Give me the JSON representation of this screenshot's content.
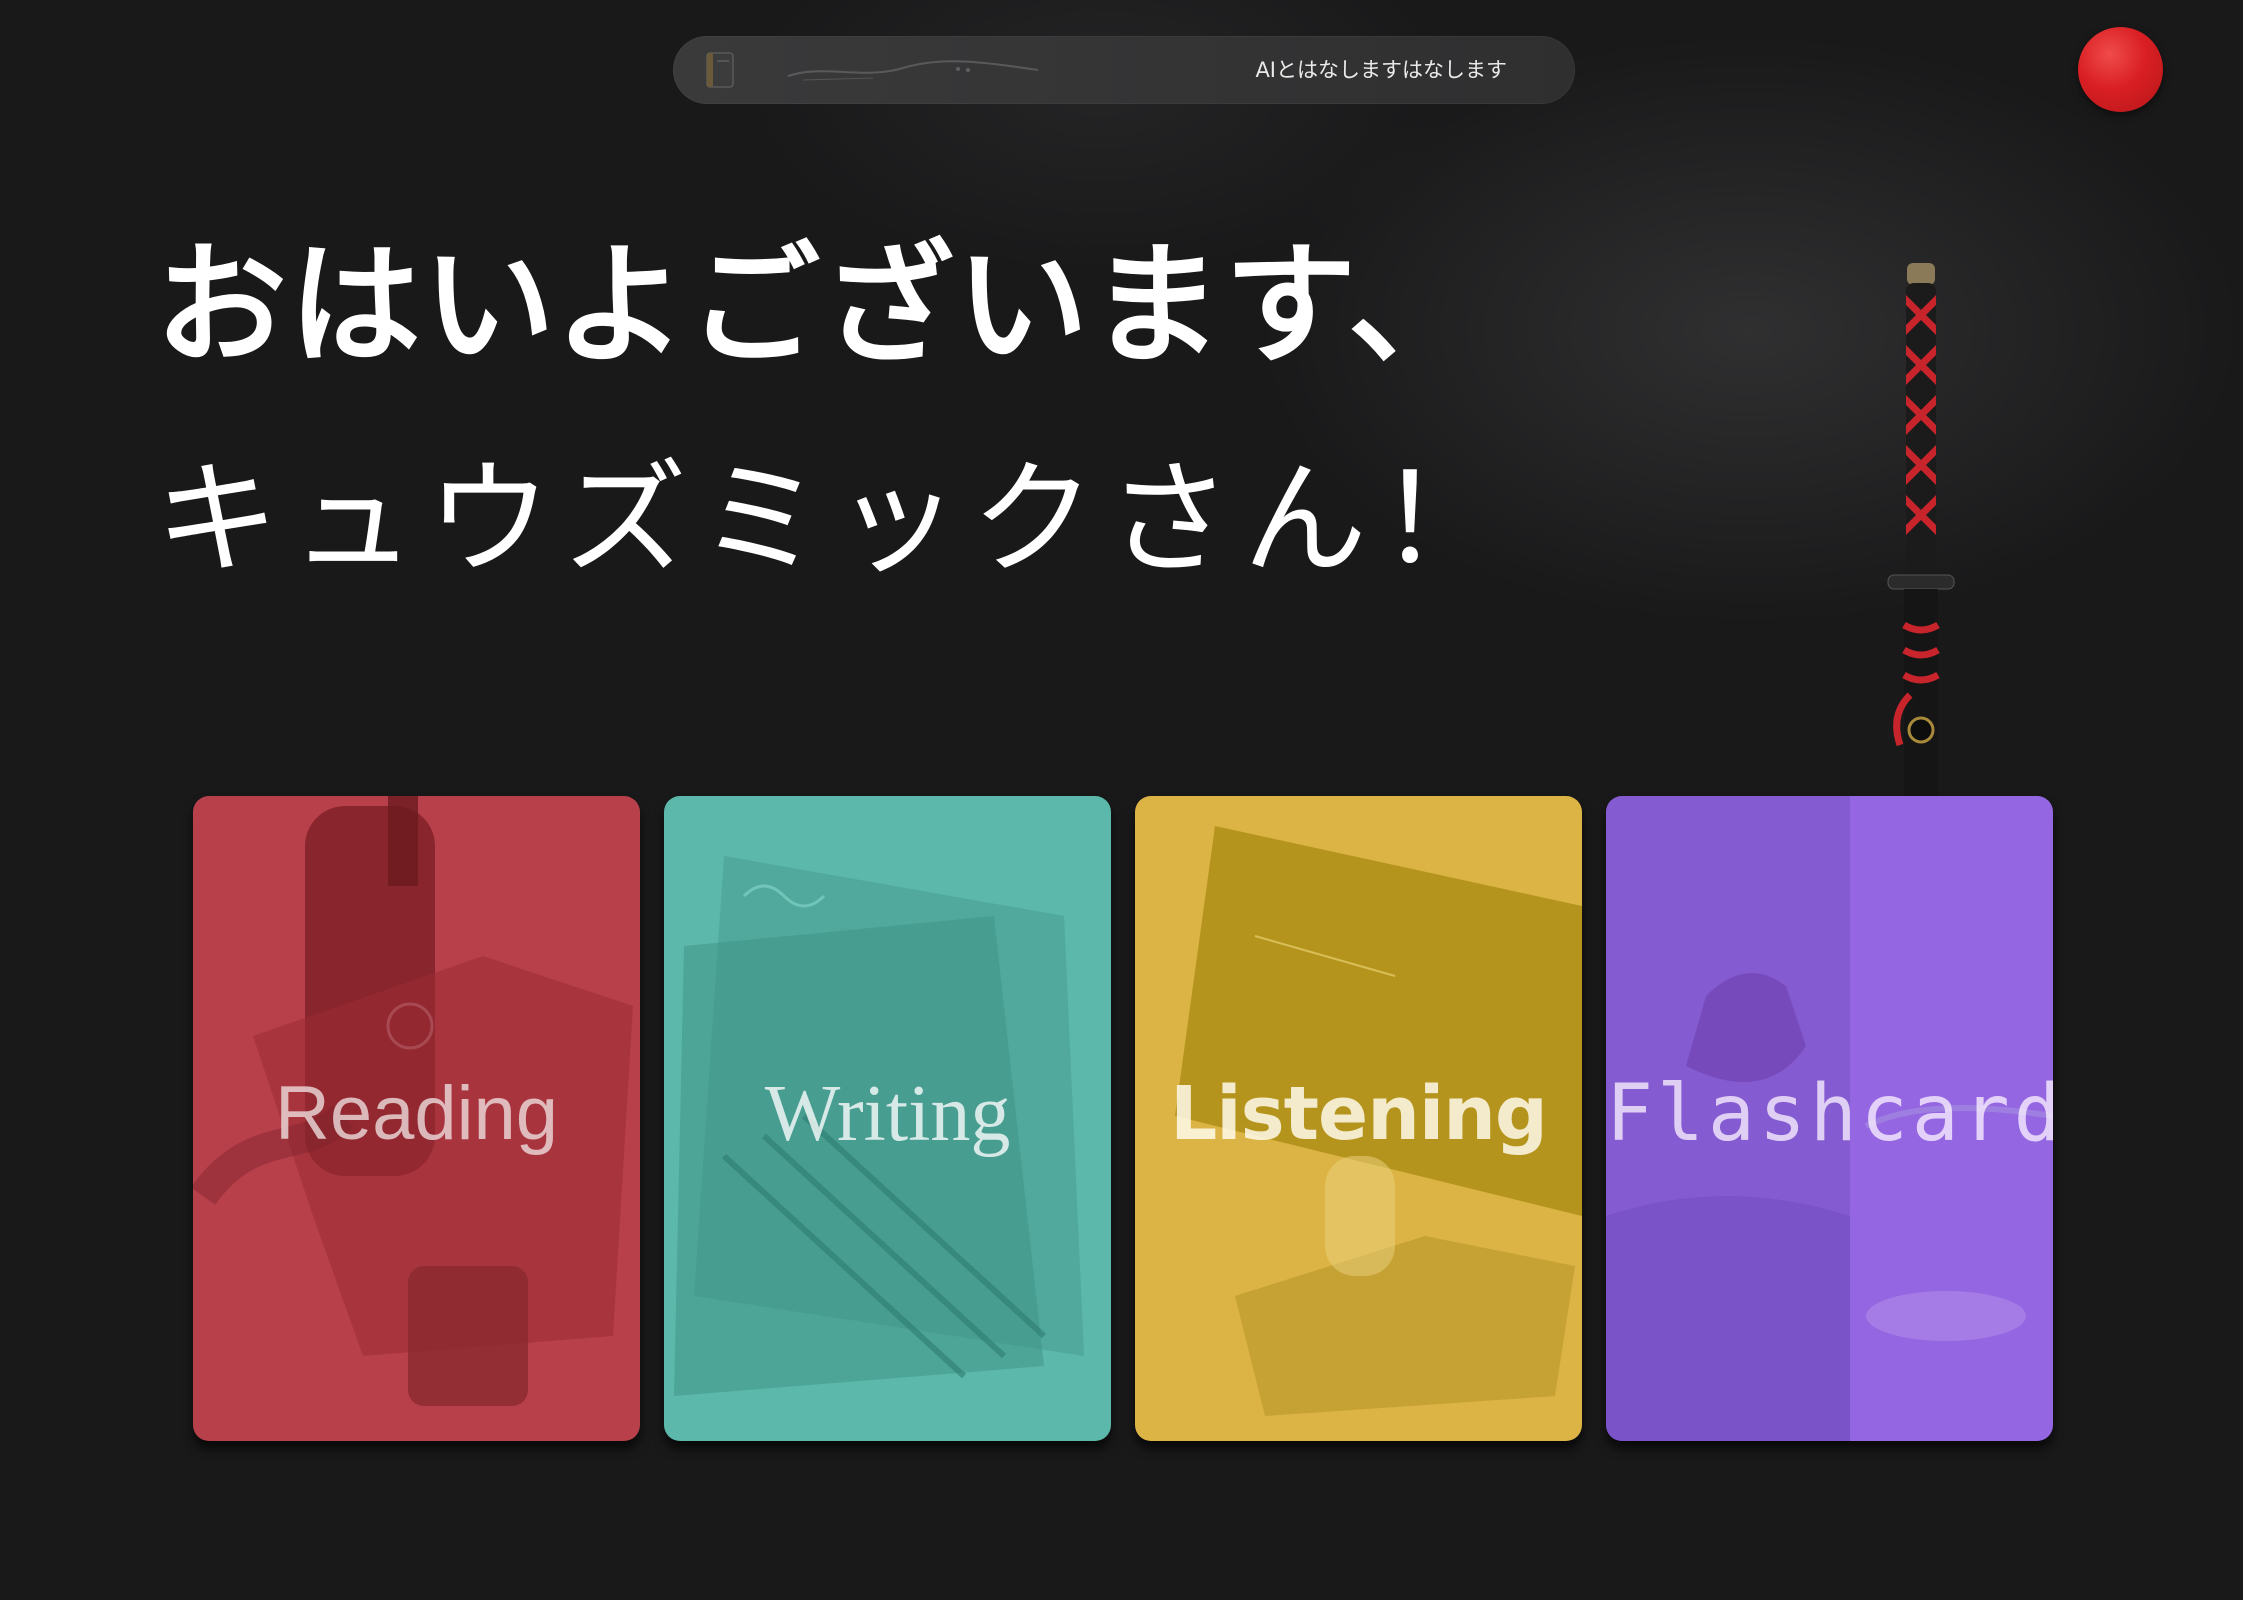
{
  "top_bar": {
    "chat_prompt": "AIとはなしますはなします",
    "book_icon": "book-icon"
  },
  "avatar": {
    "color": "#d91f23"
  },
  "greeting": {
    "line1": "おはいよございます、",
    "line2": "キュウズミックさん！"
  },
  "modes": [
    {
      "label": "Reading",
      "color": "#b8404b"
    },
    {
      "label": "Writing",
      "color": "#5bb8aa"
    },
    {
      "label": "Listening",
      "color": "#dcb445"
    },
    {
      "label": "Flashcards",
      "color": "#8f60dc"
    }
  ],
  "decor": {
    "katana": "katana-image"
  }
}
